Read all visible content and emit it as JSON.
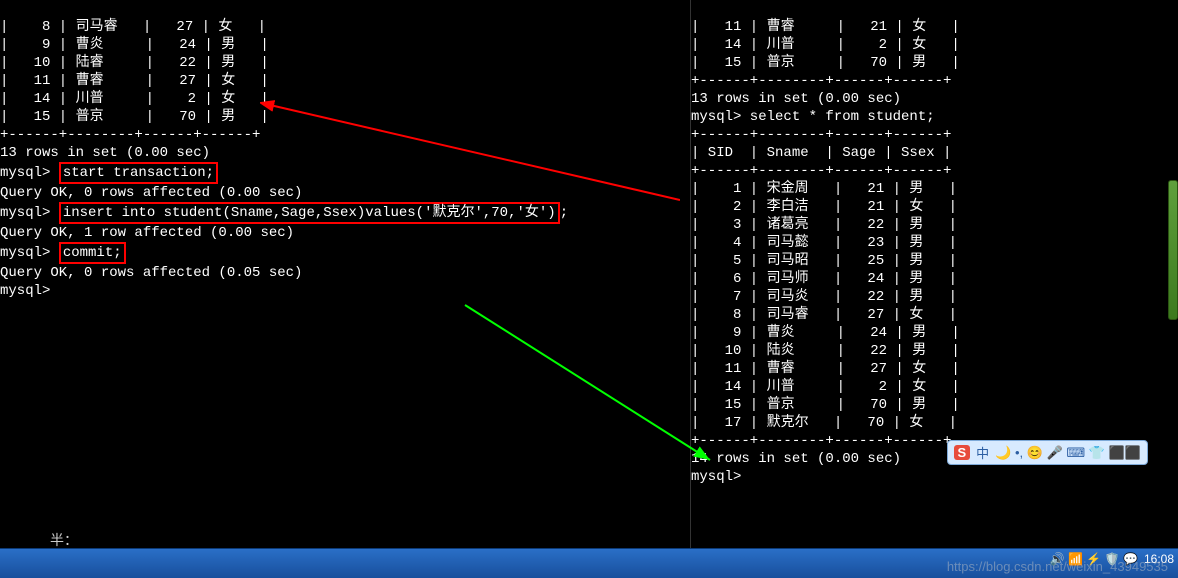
{
  "left": {
    "rows": [
      {
        "sid": "8",
        "sname": "司马睿",
        "sage": "27",
        "ssex": "女"
      },
      {
        "sid": "9",
        "sname": "曹炎",
        "sage": "24",
        "ssex": "男"
      },
      {
        "sid": "10",
        "sname": "陆睿",
        "sage": "22",
        "ssex": "男"
      },
      {
        "sid": "11",
        "sname": "曹睿",
        "sage": "27",
        "ssex": "女"
      },
      {
        "sid": "14",
        "sname": "川普",
        "sage": "2",
        "ssex": "女"
      },
      {
        "sid": "15",
        "sname": "普京",
        "sage": "70",
        "ssex": "男"
      }
    ],
    "border": "+------+--------+------+------+",
    "countline": "13 rows in set (0.00 sec)",
    "prompt": "mysql>",
    "cmd1": "start transaction;",
    "resp1": "Query OK, 0 rows affected (0.00 sec)",
    "cmd2": "insert into student(Sname,Sage,Ssex)values('默克尔',70,'女')",
    "resp2": "Query OK, 1 row affected (0.00 sec)",
    "cmd3": "commit;",
    "resp3": "Query OK, 0 rows affected (0.05 sec)",
    "halfnote": "半："
  },
  "right": {
    "topRows": [
      {
        "sid": "14",
        "sname": "川普",
        "sage": "2",
        "ssex": "女"
      },
      {
        "sid": "15",
        "sname": "普京",
        "sage": "70",
        "ssex": "男"
      }
    ],
    "toprow0": "|   11 | 曹睿     |   21 | 女   |",
    "border": "+------+--------+------+------+",
    "countline1": "13 rows in set (0.00 sec)",
    "prompt": "mysql>",
    "cmd": "select * from student;",
    "headerline": "| SID  | Sname  | Sage | Ssex |",
    "rows": [
      {
        "sid": "1",
        "sname": "宋金周",
        "sage": "21",
        "ssex": "男"
      },
      {
        "sid": "2",
        "sname": "李白洁",
        "sage": "21",
        "ssex": "女"
      },
      {
        "sid": "3",
        "sname": "诸葛亮",
        "sage": "22",
        "ssex": "男"
      },
      {
        "sid": "4",
        "sname": "司马懿",
        "sage": "23",
        "ssex": "男"
      },
      {
        "sid": "5",
        "sname": "司马昭",
        "sage": "25",
        "ssex": "男"
      },
      {
        "sid": "6",
        "sname": "司马师",
        "sage": "24",
        "ssex": "男"
      },
      {
        "sid": "7",
        "sname": "司马炎",
        "sage": "22",
        "ssex": "男"
      },
      {
        "sid": "8",
        "sname": "司马睿",
        "sage": "27",
        "ssex": "女"
      },
      {
        "sid": "9",
        "sname": "曹炎",
        "sage": "24",
        "ssex": "男"
      },
      {
        "sid": "10",
        "sname": "陆炎",
        "sage": "22",
        "ssex": "男"
      },
      {
        "sid": "11",
        "sname": "曹睿",
        "sage": "27",
        "ssex": "女"
      },
      {
        "sid": "14",
        "sname": "川普",
        "sage": "2",
        "ssex": "女"
      },
      {
        "sid": "15",
        "sname": "普京",
        "sage": "70",
        "ssex": "男"
      },
      {
        "sid": "17",
        "sname": "默克尔",
        "sage": "70",
        "ssex": "女"
      }
    ],
    "countline2": "14 rows in set (0.00 sec)"
  },
  "ime": {
    "s": "S",
    "zhong": "中",
    "items": [
      "🌙",
      "•,",
      "😊",
      "🎤",
      "⌨",
      "👕",
      "⬛⬛"
    ]
  },
  "tray": {
    "time": "16:08",
    "icons": [
      "🔊",
      "📶",
      "⚡",
      "🛡️",
      "💬"
    ]
  },
  "watermark": "https://blog.csdn.net/weixin_43949535"
}
